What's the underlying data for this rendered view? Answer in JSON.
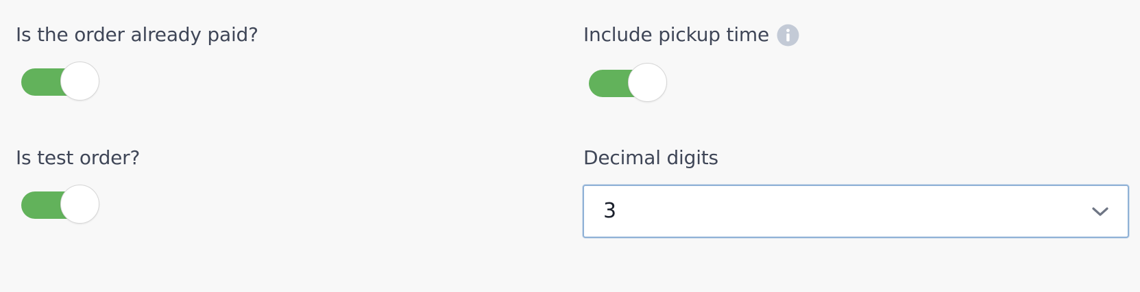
{
  "settings": {
    "paid": {
      "label": "Is the order already paid?",
      "enabled": true
    },
    "pickup": {
      "label": "Include pickup time",
      "enabled": true,
      "info_icon": "info-icon"
    },
    "test": {
      "label": "Is test order?",
      "enabled": true
    },
    "decimal": {
      "label": "Decimal digits",
      "value": "3",
      "dropdown_icon": "chevron-down-icon"
    }
  },
  "colors": {
    "toggle_on": "#62b25b",
    "label_text": "#3f4657",
    "select_border": "#8fb1d6",
    "info_icon": "#c3cad6",
    "background": "#f8f8f8"
  }
}
